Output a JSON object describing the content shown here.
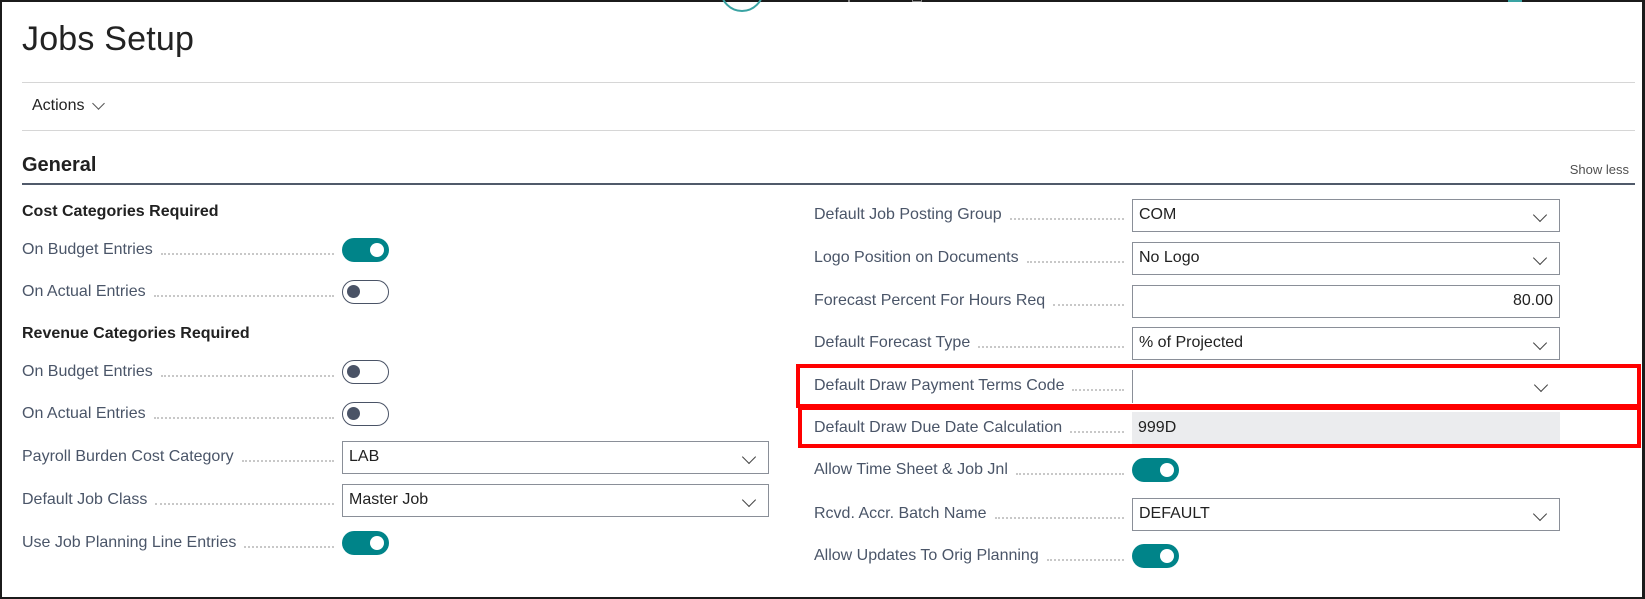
{
  "page": {
    "title": "Jobs Setup",
    "actions_label": "Actions"
  },
  "section": {
    "title": "General",
    "show_less_label": "Show less"
  },
  "left": {
    "cost_group_title": "Cost Categories Required",
    "cost_budget_label": "On Budget Entries",
    "cost_budget_value": true,
    "cost_actual_label": "On Actual Entries",
    "cost_actual_value": false,
    "revenue_group_title": "Revenue Categories Required",
    "rev_budget_label": "On Budget Entries",
    "rev_budget_value": false,
    "rev_actual_label": "On Actual Entries",
    "rev_actual_value": false,
    "payroll_label": "Payroll Burden Cost Category",
    "payroll_value": "LAB",
    "job_class_label": "Default Job Class",
    "job_class_value": "Master Job",
    "planning_label": "Use Job Planning Line Entries",
    "planning_value": true
  },
  "right": {
    "posting_group_label": "Default Job Posting Group",
    "posting_group_value": "COM",
    "logo_label": "Logo Position on Documents",
    "logo_value": "No Logo",
    "forecast_pct_label": "Forecast Percent For Hours Req",
    "forecast_pct_value": "80.00",
    "forecast_type_label": "Default Forecast Type",
    "forecast_type_value": "% of Projected",
    "draw_terms_label": "Default Draw Payment Terms Code",
    "draw_terms_value": "",
    "draw_due_label": "Default Draw Due Date Calculation",
    "draw_due_value": "999D",
    "timesheet_label": "Allow Time Sheet & Job Jnl",
    "timesheet_value": true,
    "batch_label": "Rcvd. Accr. Batch Name",
    "batch_value": "DEFAULT",
    "orig_planning_label": "Allow Updates To Orig Planning",
    "orig_planning_value": true
  },
  "colors": {
    "accent": "#008489",
    "highlight": "#ff0000",
    "readonly_bg": "#ebecee"
  }
}
